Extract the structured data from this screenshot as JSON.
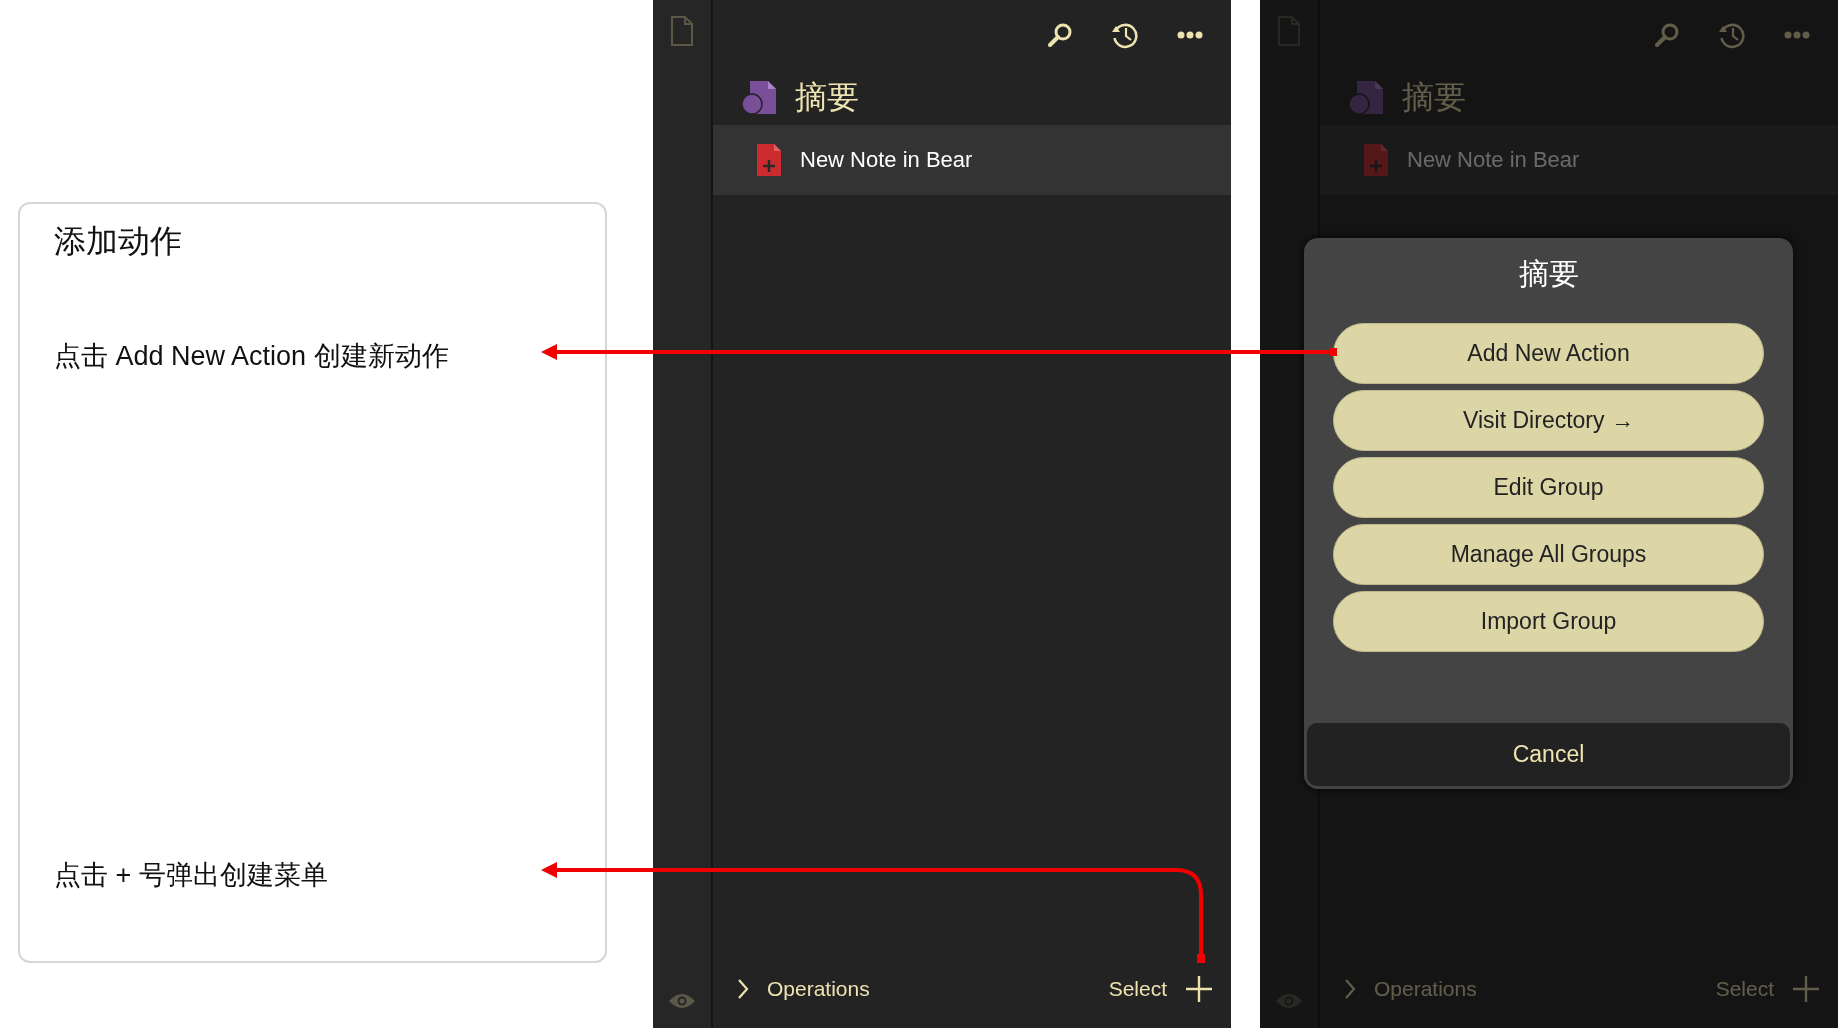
{
  "tutorial": {
    "title": "添加动作",
    "steps": [
      {
        "text": "点击 Add New Action 创建新动作"
      },
      {
        "text": "点击 + 号弹出创建菜单"
      }
    ]
  },
  "screens": [
    {
      "dimmed": false,
      "group": {
        "title": "摘要"
      },
      "actions": [
        {
          "label": "New Note in Bear"
        }
      ],
      "footer": {
        "breadcrumb": "Operations",
        "select": "Select"
      }
    },
    {
      "dimmed": true,
      "group": {
        "title": "摘要"
      },
      "actions": [
        {
          "label": "New Note in Bear"
        }
      ],
      "footer": {
        "breadcrumb": "Operations",
        "select": "Select"
      },
      "action_sheet": {
        "title": "摘要",
        "options": [
          {
            "label": "Add New Action"
          },
          {
            "label": "Visit Directory →"
          },
          {
            "label": "Edit Group"
          },
          {
            "label": "Manage All Groups"
          },
          {
            "label": "Import Group"
          }
        ],
        "cancel": "Cancel"
      }
    }
  ]
}
